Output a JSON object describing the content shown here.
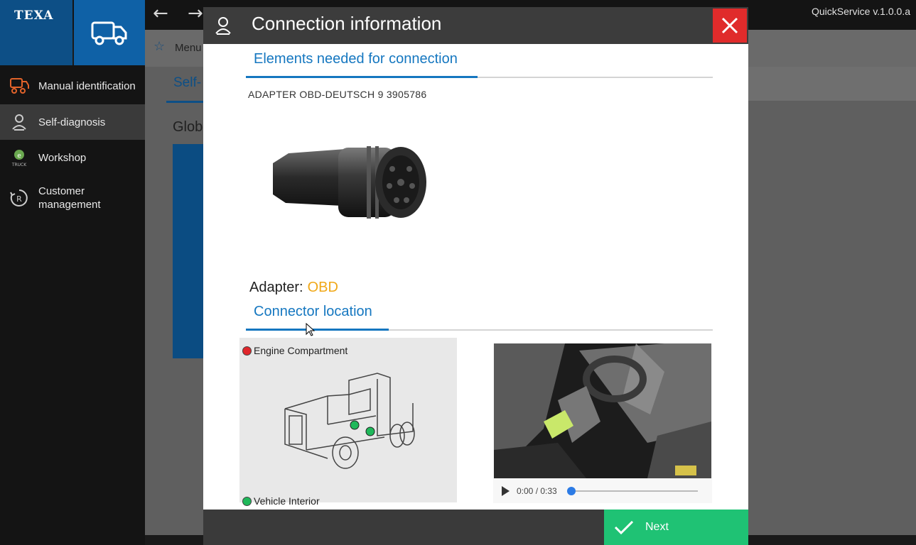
{
  "app": {
    "logo": "TEXA",
    "version": "QuickService v.1.0.0.a",
    "back_icon": "arrow-left-icon",
    "forward_icon": "arrow-right-icon"
  },
  "sidebar": {
    "items": [
      {
        "label": "Manual identification",
        "icon": "manual-identification-icon"
      },
      {
        "label": "Self-diagnosis",
        "icon": "self-diagnosis-icon",
        "active": true
      },
      {
        "label": "Workshop",
        "icon": "workshop-icon"
      },
      {
        "label": "Customer management",
        "icon": "customer-management-icon"
      }
    ]
  },
  "background": {
    "breadcrumb": "Menu",
    "subtab": "Self-",
    "section": "Glob"
  },
  "modal": {
    "title": "Connection information",
    "elements_section": "Elements needed for connection",
    "adapter_code": "ADAPTER OBD-DEUTSCH 9 3905786",
    "adapter_label": "Adapter:",
    "adapter_value": "OBD",
    "location_section": "Connector location",
    "legend": [
      {
        "label": "Engine Compartment",
        "color": "#e0262b"
      },
      {
        "label": "Vehicle Interior",
        "color": "#1fb85a"
      }
    ],
    "video": {
      "time": "0:00 / 0:33",
      "progress": 0
    },
    "next_label": "Next"
  },
  "colors": {
    "accent": "#1577c0",
    "brand": "#0d4f86",
    "close": "#e02b2b",
    "next": "#1fc274",
    "adapter_value": "#f0a818"
  }
}
